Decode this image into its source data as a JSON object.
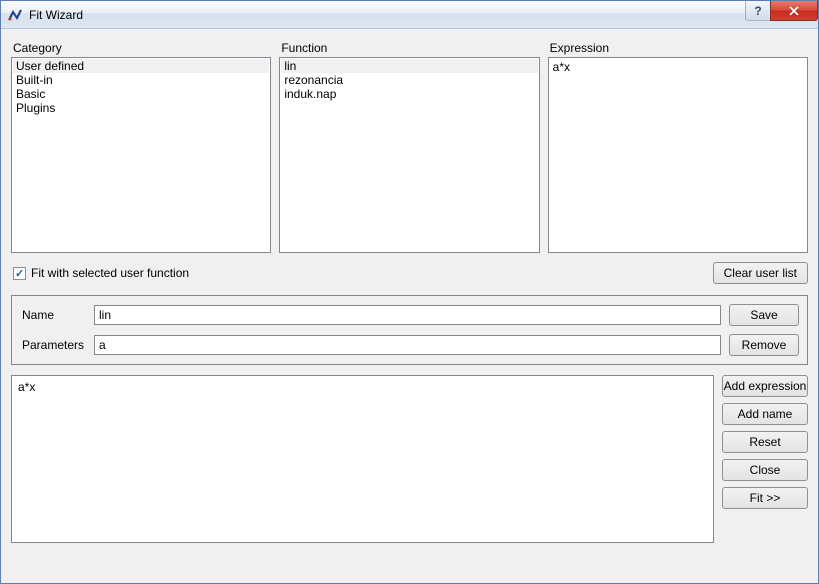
{
  "window": {
    "title": "Fit Wizard"
  },
  "labels": {
    "category": "Category",
    "function": "Function",
    "expression": "Expression",
    "fit_checkbox": "Fit with selected user function",
    "clear_user_list": "Clear user list",
    "name": "Name",
    "parameters": "Parameters",
    "save": "Save",
    "remove": "Remove",
    "add_expression": "Add expression",
    "add_name": "Add name",
    "reset": "Reset",
    "close": "Close",
    "fit": "Fit >>"
  },
  "category_items": {
    "0": "User defined",
    "1": "Built-in",
    "2": "Basic",
    "3": "Plugins"
  },
  "function_items": {
    "0": "lin",
    "1": "rezonancia",
    "2": "induk.nap"
  },
  "expression_text": "a*x",
  "fields": {
    "name_value": "lin",
    "parameters_value": "a"
  },
  "editor_text": "a*x",
  "checkbox_checked": true
}
